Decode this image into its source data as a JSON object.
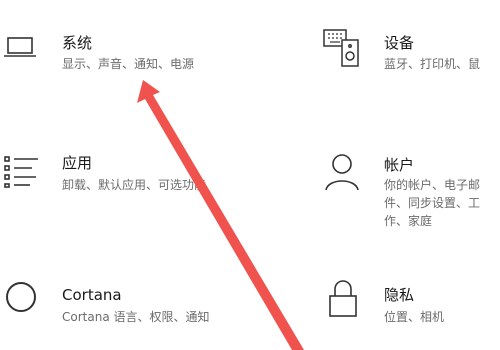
{
  "colors": {
    "background": "#ffffff",
    "title_text": "#1a1a1a",
    "desc_text": "#6b6b6b",
    "icon_stroke": "#333333",
    "annotation_arrow": "#f0524d"
  },
  "tiles": [
    {
      "id": "system",
      "icon": "laptop-icon",
      "title": "系统",
      "desc": "显示、声音、通知、电源"
    },
    {
      "id": "devices",
      "icon": "keyboard-speaker-icon",
      "title": "设备",
      "desc": "蓝牙、打印机、鼠"
    },
    {
      "id": "apps",
      "icon": "apps-list-icon",
      "title": "应用",
      "desc": "卸载、默认应用、可选功能"
    },
    {
      "id": "accounts",
      "icon": "person-icon",
      "title": "帐户",
      "desc": "你的帐户、电子邮件、同步设置、工作、家庭"
    },
    {
      "id": "cortana",
      "icon": "cortana-circle-icon",
      "title": "Cortana",
      "desc": "Cortana 语言、权限、通知"
    },
    {
      "id": "privacy",
      "icon": "lock-icon",
      "title": "隐私",
      "desc": "位置、相机"
    }
  ],
  "annotation": {
    "icon": "red-arrow-icon",
    "points_to": "system"
  }
}
